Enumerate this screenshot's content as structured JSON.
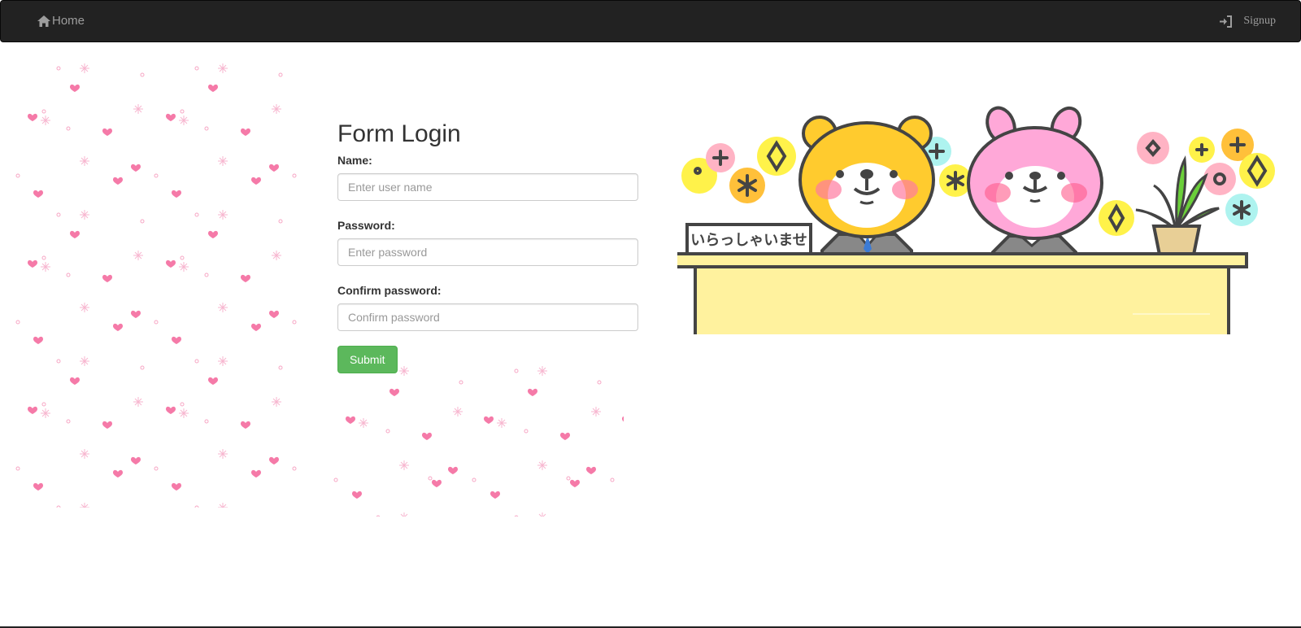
{
  "navbar": {
    "home_label": "Home",
    "home_icon": "home-icon",
    "signup_label": "Signup",
    "signup_icon": "log-in-icon",
    "background": "#222222",
    "link_color": "#9d9d9d"
  },
  "form": {
    "title": "Form Login",
    "name": {
      "label": "Name:",
      "placeholder": "Enter user name"
    },
    "password": {
      "label": "Password:",
      "placeholder": "Enter password"
    },
    "confirm": {
      "label": "Confirm password:",
      "placeholder": "Confirm password"
    },
    "submit_label": "Submit",
    "submit_color": "#5cb85c"
  },
  "illustration": {
    "sign_text": "いらっしゃいませ",
    "desk_color": "#fff29e",
    "bear_color": "#ffcb2e",
    "rabbit_color": "#ffa8d8"
  },
  "pattern": {
    "heart_color": "#f57aa8"
  }
}
